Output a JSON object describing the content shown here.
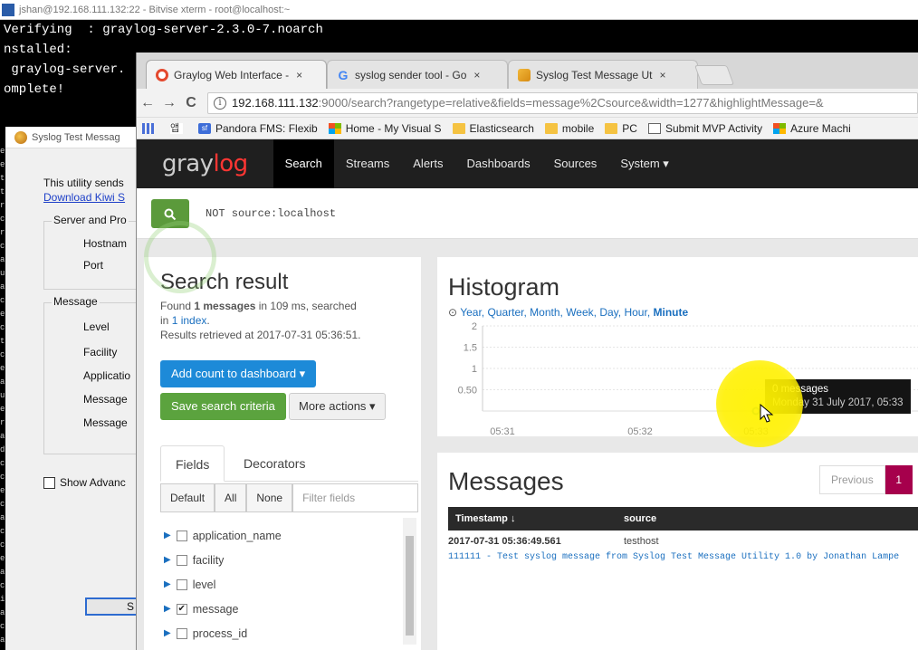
{
  "xterm": {
    "title": "jshan@192.168.111.132:22 - Bitvise xterm - root@localhost:~",
    "lines": [
      "Verifying  : graylog-server-2.3.0-7.noarch",
      "",
      "nstalled:",
      " graylog-server.",
      "",
      "omplete!"
    ]
  },
  "kiwi": {
    "title": "Syslog Test Messag",
    "intro_line": "This utility sends",
    "download_link": "Download Kiwi S",
    "server_group": "Server and Pro",
    "hostname_label": "Hostnam",
    "port_label": "Port",
    "message_group": "Message",
    "level_label": "Level",
    "facility_label": "Facility",
    "application_label": "Applicatio",
    "message_label_1": "Message",
    "message_label_2": "Message",
    "show_advanced": "Show Advanc",
    "send_button": "S"
  },
  "browser": {
    "tabs": [
      {
        "label": "Graylog Web Interface - ",
        "close": "×"
      },
      {
        "label": "syslog sender tool - Go",
        "close": "×"
      },
      {
        "label": "Syslog Test Message Ut",
        "close": "×"
      }
    ],
    "nav": {
      "back": "←",
      "forward": "→",
      "reload": "C"
    },
    "url_host": "192.168.111.132",
    "url_rest": ":9000/search?rangetype=relative&fields=message%2Csource&width=1277&highlightMessage=&",
    "bookmarks": [
      "",
      "Pandora FMS: Flexib",
      "Home - My Visual S",
      "Elasticsearch",
      "mobile",
      "PC",
      "Submit MVP Activity",
      "Azure Machi"
    ],
    "bookmark_ko": "앱"
  },
  "graylog": {
    "logo_gray": "gray",
    "logo_red": "log",
    "nav": [
      "Search",
      "Streams",
      "Alerts",
      "Dashboards",
      "Sources",
      "System ▾"
    ],
    "query": "NOT source:localhost",
    "search_result": {
      "title": "Search result",
      "found_prefix": "Found ",
      "found_count": "1 messages",
      "found_suffix": " in 109 ms, searched",
      "in_prefix": "in ",
      "index_link": "1 index",
      "in_suffix": ".",
      "retrieved": "Results retrieved at 2017-07-31 05:36:51."
    },
    "buttons": {
      "add_count": "Add count to dashboard ▾",
      "save_search": "Save search criteria",
      "more_actions": "More actions ▾"
    },
    "field_tabs": [
      "Fields",
      "Decorators"
    ],
    "field_filter_buttons": [
      "Default",
      "All",
      "None"
    ],
    "filter_placeholder": "Filter fields",
    "fields": [
      {
        "name": "application_name",
        "checked": false
      },
      {
        "name": "facility",
        "checked": false
      },
      {
        "name": "level",
        "checked": false
      },
      {
        "name": "message",
        "checked": true
      },
      {
        "name": "process_id",
        "checked": false
      }
    ],
    "histogram": {
      "title": "Histogram",
      "resolutions": [
        "Year",
        "Quarter",
        "Month",
        "Week",
        "Day",
        "Hour",
        "Minute"
      ],
      "active_resolution": "Minute",
      "tooltip_title": "0 messages",
      "tooltip_sub": "Monday 31 July 2017, 05:33"
    },
    "messages": {
      "title": "Messages",
      "previous": "Previous",
      "page": "1",
      "col_timestamp": "Timestamp",
      "col_timestamp_icon": "↓",
      "col_source": "source",
      "rows": [
        {
          "timestamp": "2017-07-31 05:36:49.561",
          "source": "testhost",
          "message": "111111 - Test syslog message from Syslog Test Message Utility 1.0 by Jonathan Lampe"
        }
      ]
    }
  },
  "chart_data": {
    "type": "line",
    "x_ticks": [
      "05:31",
      "05:32",
      "05:33"
    ],
    "y_ticks": [
      "2",
      "1.5",
      "1",
      "0.50"
    ],
    "ylim": [
      0,
      2
    ],
    "points": [
      {
        "x": "05:33",
        "y": 0
      }
    ],
    "grid": true
  },
  "colors": {
    "graylog_red": "#ff3633",
    "search_green": "#5b9a3b",
    "primary_blue": "#1d8ad8",
    "pager_active": "#a6004c"
  }
}
